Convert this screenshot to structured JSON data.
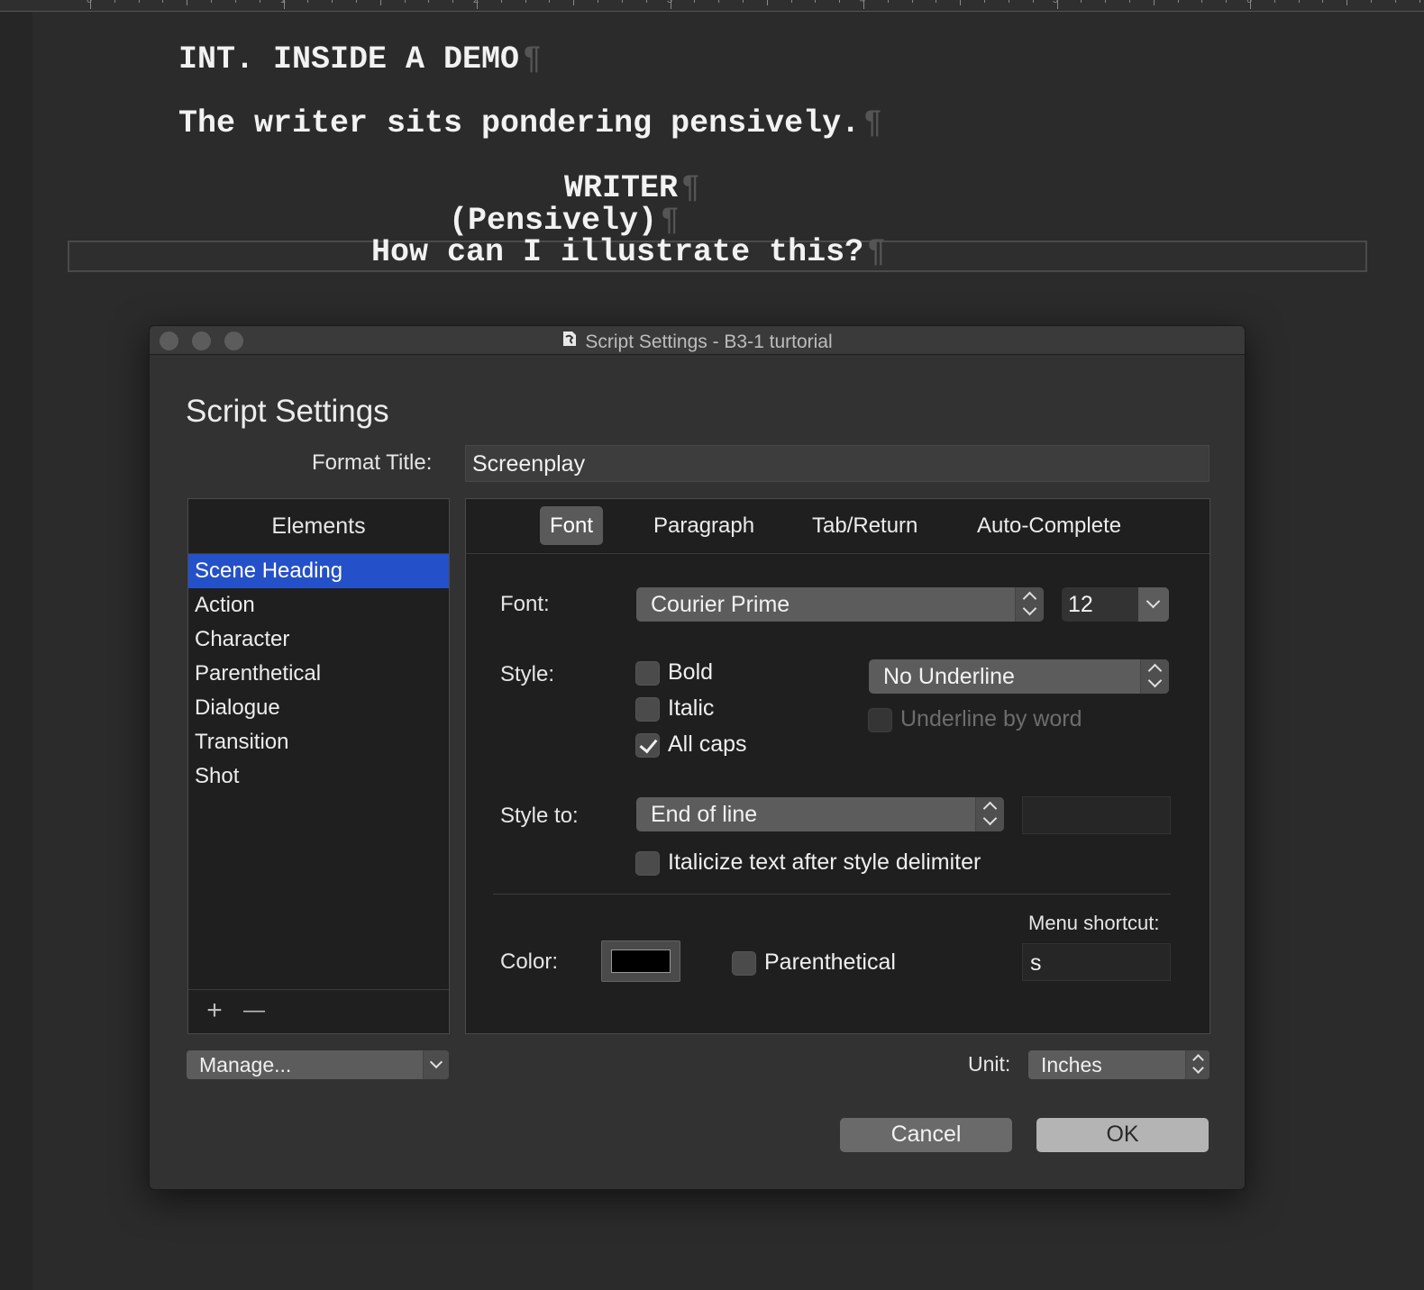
{
  "ruler": {
    "ticks": [
      "0",
      "1",
      "2",
      "3",
      "4",
      "5",
      "6"
    ]
  },
  "script": {
    "scene_heading": "INT. INSIDE A DEMO",
    "action": "The writer sits pondering pensively.",
    "character": "WRITER",
    "parenthetical": "(Pensively)",
    "dialogue": "How can I illustrate this?",
    "pilcrow": "¶"
  },
  "dialog": {
    "window_title": "Script Settings - B3-1 turtorial",
    "heading": "Script Settings",
    "format_title_label": "Format Title:",
    "format_title_value": "Screenplay",
    "elements_header": "Elements",
    "elements": [
      "Scene Heading",
      "Action",
      "Character",
      "Parenthetical",
      "Dialogue",
      "Transition",
      "Shot"
    ],
    "selected_element": "Scene Heading",
    "add_symbol": "+",
    "remove_symbol": "—",
    "tabs": [
      "Font",
      "Paragraph",
      "Tab/Return",
      "Auto-Complete"
    ],
    "active_tab": "Font",
    "font_label": "Font:",
    "font_value": "Courier Prime",
    "size_value": "12",
    "style_label": "Style:",
    "bold_label": "Bold",
    "bold_checked": false,
    "italic_label": "Italic",
    "italic_checked": false,
    "allcaps_label": "All caps",
    "allcaps_checked": true,
    "underline_value": "No Underline",
    "underline_by_word_label": "Underline by word",
    "style_to_label": "Style to:",
    "style_to_value": "End of line",
    "style_to_delimiter_value": "",
    "italicize_label": "Italicize text after style delimiter",
    "menu_shortcut_label": "Menu shortcut:",
    "color_label": "Color:",
    "color_value": "#000000",
    "parenthetical_label": "Parenthetical",
    "shortcut_value": "s",
    "manage_label": "Manage...",
    "unit_label": "Unit:",
    "unit_value": "Inches",
    "cancel_label": "Cancel",
    "ok_label": "OK"
  },
  "colors": {
    "selection": "#2450c9",
    "background": "#2b2b2b",
    "panel": "#1f1f1f"
  },
  "icons": {
    "window_doc": "script-doc-icon",
    "checkmark": "checkmark-icon"
  }
}
